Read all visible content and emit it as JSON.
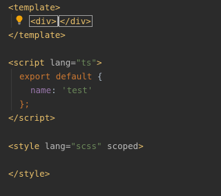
{
  "editor": {
    "lines": {
      "l1": {
        "open": "<",
        "name": "template",
        "close": ">"
      },
      "l2": {
        "a_open": "<",
        "a_name": "div",
        "a_close": ">",
        "b_open": "</",
        "b_name": "div",
        "b_close": ">"
      },
      "l3": {
        "open": "</",
        "name": "template",
        "close": ">"
      },
      "l5": {
        "open": "<",
        "name": "script",
        "attr": "lang",
        "eq": "=",
        "val": "\"ts\"",
        "close": ">"
      },
      "l6": {
        "kw1": "export",
        "kw2": "default",
        "brace": "{"
      },
      "l7": {
        "prop": "name",
        "colon": ":",
        "val": "'test'"
      },
      "l8": {
        "brace": "};"
      },
      "l9": {
        "open": "</",
        "name": "script",
        "close": ">"
      },
      "l11": {
        "open": "<",
        "name": "style",
        "attr1": "lang",
        "eq": "=",
        "val": "\"scss\"",
        "attr2": "scoped",
        "close": ">"
      },
      "l13": {
        "open": "</",
        "name": "style",
        "close": ">"
      }
    },
    "intention_icon": "lightbulb-icon",
    "colors": {
      "background": "#2b2b2b",
      "tag": "#e8bf6a",
      "attribute": "#bababa",
      "string": "#6a8759",
      "keyword": "#cc7832",
      "property": "#9876aa",
      "text": "#a9b7c6"
    }
  }
}
